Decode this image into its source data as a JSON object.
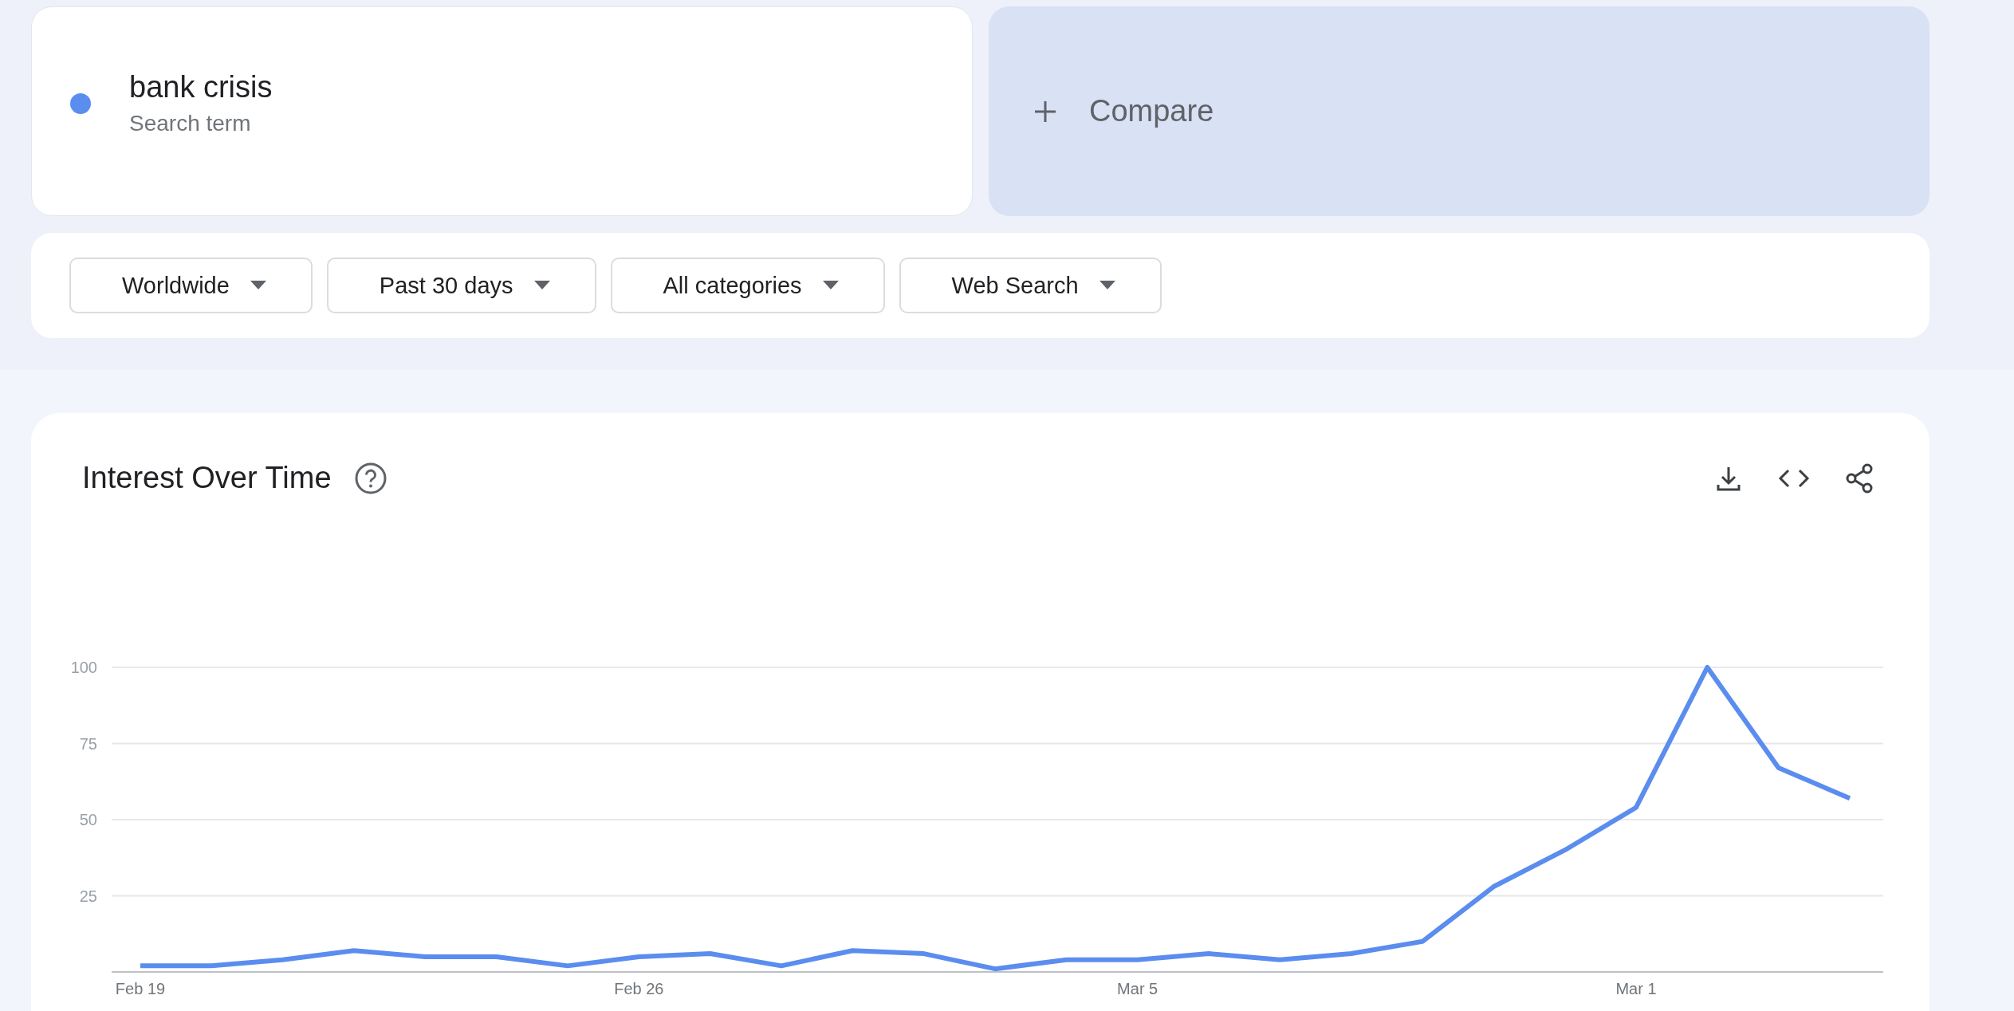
{
  "search_term": {
    "label": "bank crisis",
    "sublabel": "Search term",
    "color": "#5b8def"
  },
  "compare": {
    "label": "Compare"
  },
  "filters": [
    {
      "label": "Worldwide"
    },
    {
      "label": "Past 30 days"
    },
    {
      "label": "All categories"
    },
    {
      "label": "Web Search"
    }
  ],
  "interest_over_time": {
    "title": "Interest Over Time",
    "chart_data": {
      "type": "line",
      "categories": [
        "Feb 19",
        null,
        null,
        null,
        null,
        null,
        null,
        "Feb 26",
        null,
        null,
        null,
        null,
        null,
        null,
        "Mar 5",
        null,
        null,
        null,
        null,
        null,
        null,
        "Mar 1",
        null,
        null,
        null
      ],
      "series": [
        {
          "color": "#5b8def",
          "values": [
            2,
            2,
            4,
            7,
            5,
            5,
            2,
            5,
            6,
            2,
            7,
            6,
            1,
            4,
            4,
            6,
            4,
            6,
            10,
            28,
            40,
            54,
            100,
            67,
            57
          ]
        }
      ],
      "ylim": [
        0,
        100
      ],
      "yticks": [
        25,
        50,
        75,
        100
      ],
      "grid": true
    }
  }
}
